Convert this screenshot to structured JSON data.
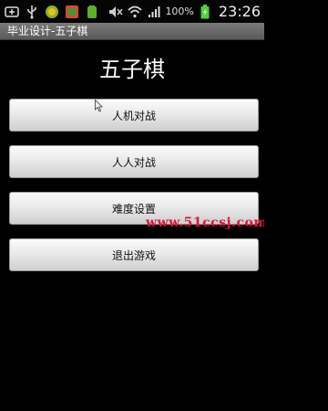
{
  "status_bar": {
    "battery_percent": "100%",
    "time": "23:26",
    "icons": [
      "notification-icon",
      "usb-icon",
      "app-icon",
      "game-icon",
      "android-icon",
      "mute-icon",
      "wifi-icon",
      "signal-icon",
      "battery-icon"
    ]
  },
  "title_bar": {
    "title": "毕业设计-五子棋"
  },
  "main": {
    "heading": "五子棋",
    "buttons": [
      "人机对战",
      "人人对战",
      "难度设置",
      "退出游戏"
    ]
  },
  "watermark": "www.51ccsj.com",
  "colors": {
    "background": "#000000",
    "watermark": "#e0133a",
    "battery": "#4cd137"
  }
}
